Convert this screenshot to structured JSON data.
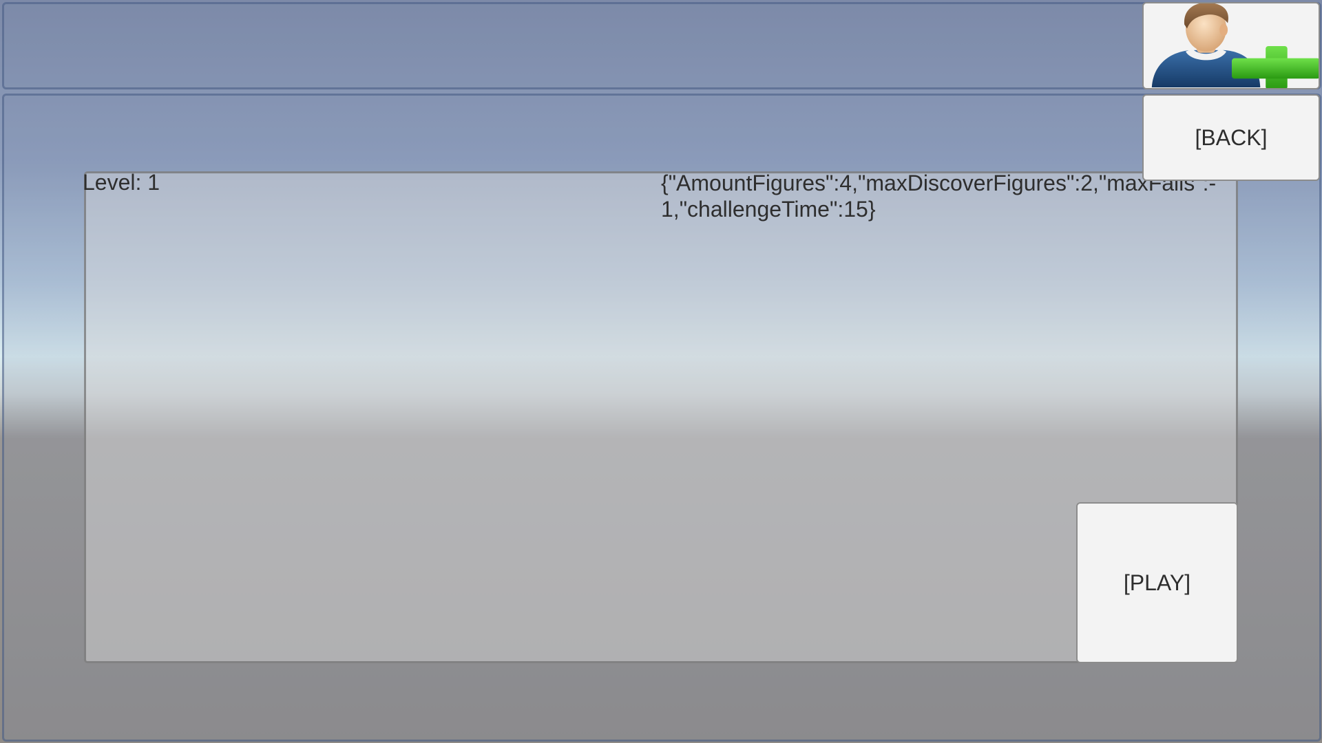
{
  "header": {
    "add_user_icon": "add-user-icon"
  },
  "nav": {
    "back_label": "[BACK]"
  },
  "level": {
    "label": "Level: 1",
    "config": "{\"AmountFigures\":4,\"maxDiscoverFigures\":2,\"maxFails\":-1,\"challengeTime\":15}",
    "play_label": "[PLAY]"
  },
  "colors": {
    "button_bg": "#f3f3f3",
    "button_text": "#2e2e2e",
    "plus_green": "#3cbf1e"
  }
}
